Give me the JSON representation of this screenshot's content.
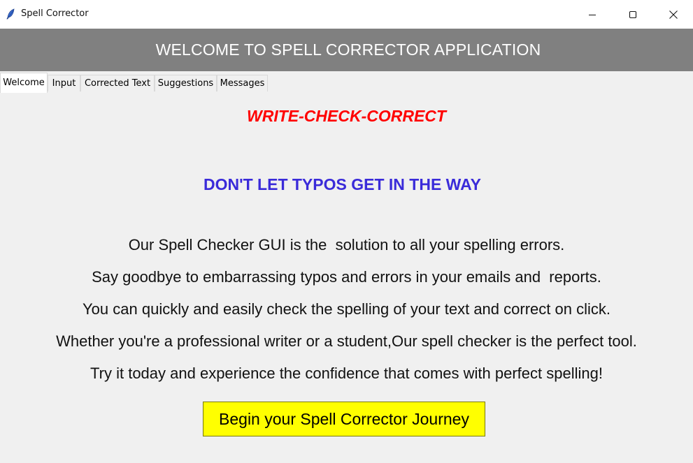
{
  "window": {
    "title": "Spell Corrector",
    "icon": "feather-icon"
  },
  "header": {
    "title": "WELCOME TO SPELL CORRECTOR APPLICATION",
    "background": "#808080"
  },
  "tabs": [
    {
      "label": "Welcome",
      "active": true
    },
    {
      "label": "Input",
      "active": false
    },
    {
      "label": "Corrected Text",
      "active": false
    },
    {
      "label": "Suggestions",
      "active": false
    },
    {
      "label": "Messages",
      "active": false
    }
  ],
  "welcome": {
    "tagline": "WRITE-CHECK-CORRECT",
    "tagline_color": "#ff0000",
    "headline": "DON'T LET TYPOS GET IN THE WAY",
    "headline_color": "#3a2bd9",
    "paragraphs": [
      "Our Spell Checker GUI is the  solution to all your spelling errors.",
      "Say goodbye to embarrassing typos and errors in your emails and  reports.",
      "You can quickly and easily check the spelling of your text and correct on click.",
      "Whether you're a professional writer or a student,Our spell checker is the perfect tool.",
      "Try it today and experience the confidence that comes with perfect spelling!"
    ],
    "cta_label": "Begin your Spell Corrector Journey",
    "cta_color": "#ffff00"
  }
}
